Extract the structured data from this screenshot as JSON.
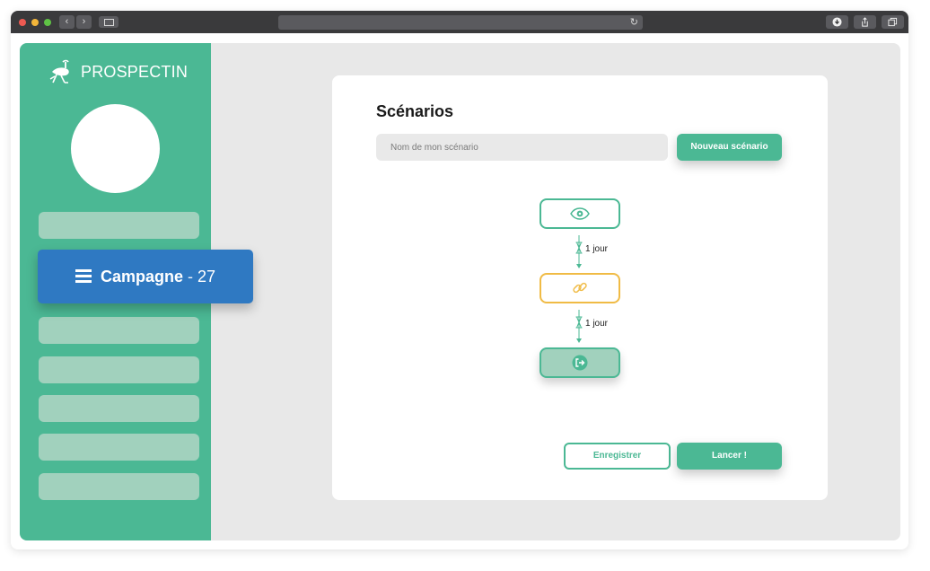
{
  "browser": {
    "window_controls": [
      "close-dot",
      "minimize-dot",
      "maximize-dot"
    ],
    "nav": {
      "back_icon": "‹",
      "forward_icon": "›"
    },
    "reload_icon": "↻",
    "toolbar_icons": [
      "download-icon",
      "share-icon",
      "tabs-icon"
    ]
  },
  "sidebar": {
    "brand": "PROSPECTIN",
    "logo_icon": "ostrich-icon",
    "active_item": {
      "label": "Campagne",
      "separator": "-",
      "count": "27",
      "icon": "menu-icon"
    }
  },
  "scenario": {
    "title": "Scénarios",
    "name_placeholder": "Nom de mon scénario",
    "new_button": "Nouveau scénario",
    "steps": [
      {
        "type": "view",
        "icon": "eye-icon"
      },
      {
        "type": "link",
        "icon": "link-icon"
      },
      {
        "type": "exit",
        "icon": "exit-icon"
      }
    ],
    "delays": [
      "1 jour",
      "1 jour"
    ],
    "save_button": "Enregistrer",
    "launch_button": "Lancer !"
  },
  "colors": {
    "brand_green": "#4bb894",
    "light_green": "#a1d1bd",
    "blue": "#2f79c2",
    "yellow": "#f0bb45"
  }
}
